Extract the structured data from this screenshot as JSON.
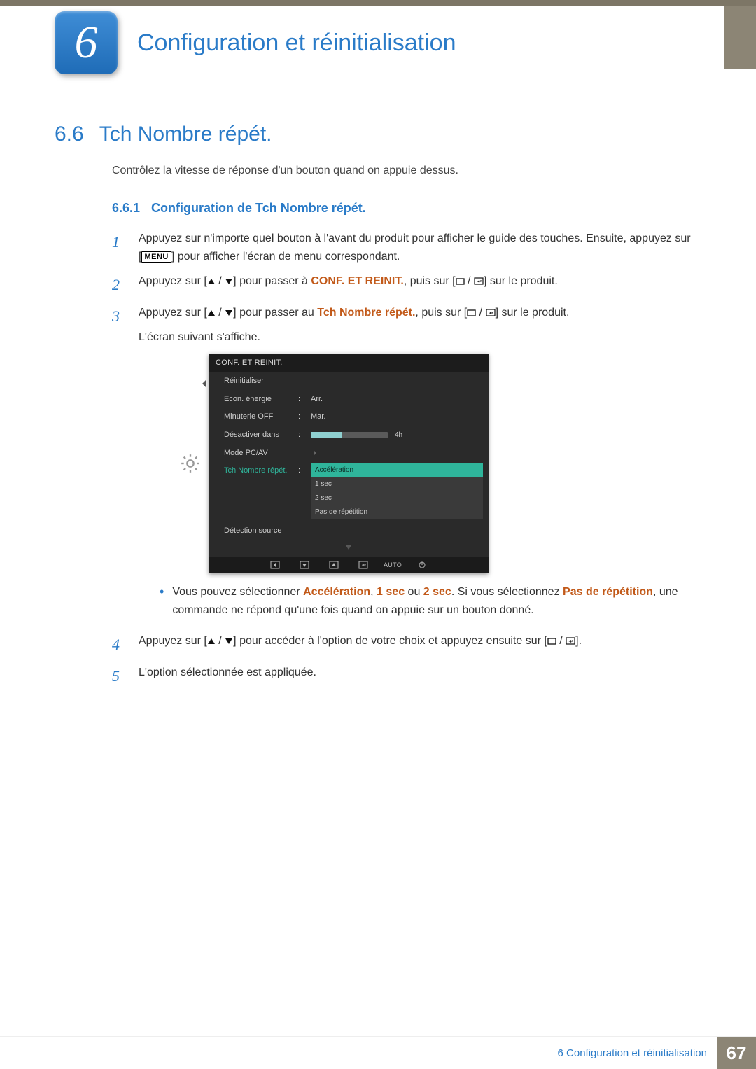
{
  "chapter": {
    "number": "6",
    "title": "Configuration et réinitialisation"
  },
  "section": {
    "number": "6.6",
    "title": "Tch Nombre répét."
  },
  "intro": "Contrôlez la vitesse de réponse d'un bouton quand on appuie dessus.",
  "subsection": {
    "number": "6.6.1",
    "title": "Configuration de Tch Nombre répét."
  },
  "steps": {
    "s1": {
      "num": "1",
      "a": "Appuyez sur n'importe quel bouton à l'avant du produit pour afficher le guide des touches. Ensuite, appuyez sur [",
      "menu": "MENU",
      "b": "] pour afficher l'écran de menu correspondant."
    },
    "s2": {
      "num": "2",
      "a": "Appuyez sur [",
      "b": "] pour passer à ",
      "hl": "CONF. ET REINIT.",
      "c": ", puis sur [",
      "d": "] sur le produit."
    },
    "s3": {
      "num": "3",
      "a": "Appuyez sur [",
      "b": "] pour passer au ",
      "hl": "Tch Nombre répét.",
      "c": ", puis sur [",
      "d": "] sur le produit.",
      "e": "L'écran suivant s'affiche."
    },
    "bullet": {
      "a": "Vous pouvez sélectionner ",
      "h1": "Accélération",
      "b": ", ",
      "h2": "1 sec",
      "c": " ou ",
      "h3": "2 sec",
      "d": ". Si vous sélectionnez ",
      "h4": "Pas de répétition",
      "e": ", une commande ne répond qu'une fois quand on appuie sur un bouton donné."
    },
    "s4": {
      "num": "4",
      "a": "Appuyez sur [",
      "b": "] pour accéder à l'option de votre choix et appuyez ensuite sur [",
      "c": "]."
    },
    "s5": {
      "num": "5",
      "a": "L'option sélectionnée est appliquée."
    }
  },
  "osd": {
    "title": "CONF. ET REINIT.",
    "rows": {
      "r1": {
        "label": "Réinitialiser",
        "val": ""
      },
      "r2": {
        "label": "Econ. énergie",
        "val": "Arr."
      },
      "r3": {
        "label": "Minuterie OFF",
        "val": "Mar."
      },
      "r4": {
        "label": "Désactiver dans",
        "val_num": "4h"
      },
      "r5": {
        "label": "Mode PC/AV",
        "val": ""
      },
      "r6": {
        "label": "Tch Nombre répét."
      },
      "r7": {
        "label": "Détection source"
      }
    },
    "dropdown": {
      "o1": "Accélération",
      "o2": "1 sec",
      "o3": "2 sec",
      "o4": "Pas de répétition"
    },
    "footer_auto": "AUTO"
  },
  "footer": {
    "label": "6 Configuration et réinitialisation",
    "page": "67"
  }
}
